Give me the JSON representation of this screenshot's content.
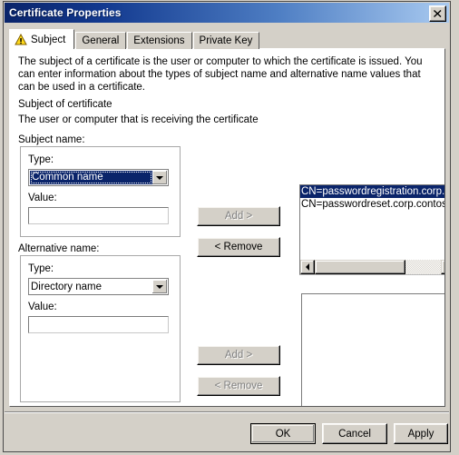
{
  "window": {
    "title": "Certificate Properties",
    "close_label": "close-icon"
  },
  "tabs": [
    {
      "label": "Subject",
      "active": true,
      "icon": "warning-triangle-icon"
    },
    {
      "label": "General",
      "active": false
    },
    {
      "label": "Extensions",
      "active": false
    },
    {
      "label": "Private Key",
      "active": false
    }
  ],
  "subject_tab": {
    "intro": "The subject of a certificate is the user or computer to which the certificate is issued. You can enter information about the types of subject name and alternative name values that can be used in a certificate.",
    "section_heading": "Subject of certificate",
    "section_description": "The user or computer that is receiving the certificate",
    "subject_name": {
      "group_label": "Subject name:",
      "type_label": "Type:",
      "type_value": "Common name",
      "value_label": "Value:",
      "value_text": "",
      "add_label": "Add >",
      "add_enabled": false,
      "remove_label": "< Remove",
      "remove_enabled": true,
      "list_items": [
        {
          "text": "CN=passwordregistration.corp.co",
          "selected": true
        },
        {
          "text": "CN=passwordreset.corp.contoso.",
          "selected": false
        }
      ],
      "scrollbar": {
        "left_arrow": "scroll-left-icon",
        "right_arrow": "scroll-right-icon",
        "thumb_fraction": 72
      }
    },
    "alternative_name": {
      "group_label": "Alternative name:",
      "type_label": "Type:",
      "type_value": "Directory name",
      "value_label": "Value:",
      "value_text": "",
      "add_label": "Add >",
      "add_enabled": false,
      "remove_label": "< Remove",
      "remove_enabled": false,
      "list_items": []
    }
  },
  "footer": {
    "ok_label": "OK",
    "cancel_label": "Cancel",
    "apply_label": "Apply"
  },
  "colors": {
    "title_gradient_start": "#0a246a",
    "title_gradient_end": "#a9caf0",
    "selection": "#0a246a",
    "face": "#d4d0c8",
    "warning_yellow": "#ffd91a"
  }
}
